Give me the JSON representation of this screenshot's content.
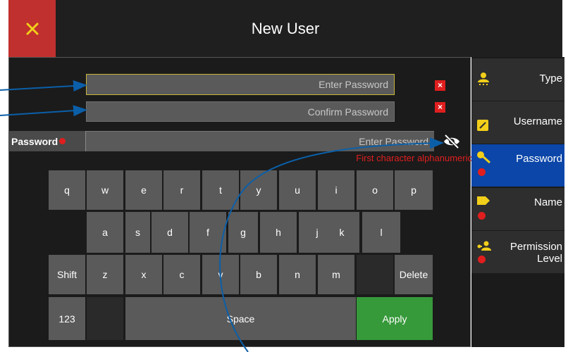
{
  "header": {
    "title": "New User",
    "close_icon": "close-icon"
  },
  "password_form": {
    "enter_placeholder": "Enter Password",
    "confirm_placeholder": "Confirm Password",
    "clear_glyph": "×",
    "row_label": "Password",
    "row_entry_text": "Enter Password",
    "hint": "First character alphanumeric"
  },
  "keyboard": {
    "row1": [
      "q",
      "w",
      "e",
      "r",
      "t",
      "y",
      "u",
      "i",
      "o",
      "p"
    ],
    "row2": [
      "a",
      "s",
      "d",
      "f",
      "g",
      "h",
      "j",
      "k",
      "l"
    ],
    "row3": [
      "Shift",
      "z",
      "x",
      "c",
      "v",
      "b",
      "n",
      "m",
      "",
      "Delete"
    ],
    "row4": [
      "123",
      "",
      "Space",
      "Apply"
    ]
  },
  "sidebar": {
    "items": [
      {
        "label": "Type",
        "icon": "user-type-icon",
        "required": false,
        "active": false
      },
      {
        "label": "Username",
        "icon": "edit-icon",
        "required": false,
        "active": false
      },
      {
        "label": "Password",
        "icon": "key-icon",
        "required": true,
        "active": true
      },
      {
        "label": "Name",
        "icon": "tag-icon",
        "required": true,
        "active": false
      },
      {
        "label": "Permission Level",
        "icon": "users-icon",
        "required": true,
        "active": false
      }
    ]
  },
  "colors": {
    "accent_yellow": "#f2cf1a",
    "required_red": "#e01e1e",
    "active_blue": "#0b46a8",
    "apply_green": "#36993a",
    "close_red": "#c0302e"
  }
}
